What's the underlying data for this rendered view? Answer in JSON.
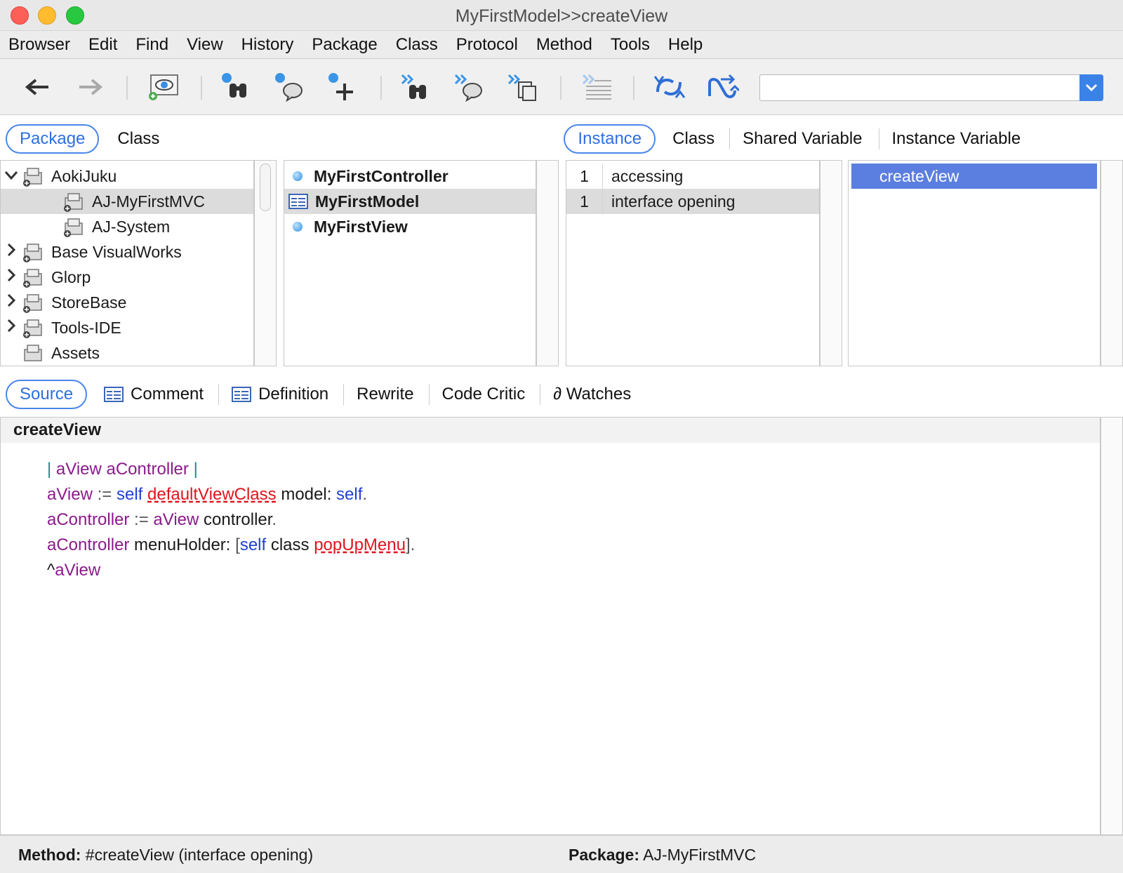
{
  "window": {
    "title": "MyFirstModel>>createView"
  },
  "menu": [
    "Browser",
    "Edit",
    "Find",
    "View",
    "History",
    "Package",
    "Class",
    "Protocol",
    "Method",
    "Tools",
    "Help"
  ],
  "toolbar": {
    "buttons": [
      "back-arrow-icon",
      "forward-arrow-icon",
      "inspect-eye-icon",
      "find-class-binoculars-icon",
      "find-method-icon",
      "add-icon",
      "find-next-class-icon",
      "find-next-method-icon",
      "find-next-copy-icon",
      "format-lines-icon",
      "sync-icon",
      "shuffle-icon"
    ],
    "search_value": ""
  },
  "top_tabs": {
    "left": [
      {
        "label": "Package",
        "active": true
      },
      {
        "label": "Class",
        "active": false
      }
    ],
    "right": [
      {
        "label": "Instance",
        "active": true
      },
      {
        "label": "Class",
        "active": false
      },
      {
        "label": "Shared Variable",
        "active": false
      },
      {
        "label": "Instance Variable",
        "active": false
      }
    ]
  },
  "packages": [
    {
      "label": "AokiJuku",
      "expanded": true
    },
    {
      "label": "AJ-MyFirstMVC",
      "selected": true
    },
    {
      "label": "AJ-System"
    },
    {
      "label": "Base VisualWorks"
    },
    {
      "label": "Glorp"
    },
    {
      "label": "StoreBase"
    },
    {
      "label": "Tools-IDE"
    },
    {
      "label": "Assets"
    }
  ],
  "classes": [
    {
      "label": "MyFirstController"
    },
    {
      "label": "MyFirstModel",
      "selected": true
    },
    {
      "label": "MyFirstView"
    }
  ],
  "protocols": [
    {
      "count": "1",
      "label": "accessing"
    },
    {
      "count": "1",
      "label": "interface opening",
      "selected": true
    }
  ],
  "methods": [
    {
      "label": "createView",
      "selected": true
    }
  ],
  "bottom_tabs": [
    {
      "label": "Source",
      "active": true
    },
    {
      "label": "Comment"
    },
    {
      "label": "Definition"
    },
    {
      "label": "Rewrite"
    },
    {
      "label": "Code Critic"
    },
    {
      "label": "∂ Watches"
    }
  ],
  "code": {
    "header": "createView",
    "line1": {
      "bar1": "|",
      "temps": " aView aController ",
      "bar2": "|"
    },
    "line2": {
      "v": "aView",
      "assign": " := ",
      "self": "self",
      "sel": "defaultViewClass",
      "kw": " model: ",
      "self2": "self",
      "dot": "."
    },
    "line3": {
      "v": "aController",
      "assign": " := ",
      "v2": "aView",
      "msg": " controller",
      "dot": "."
    },
    "line4": {
      "v": "aController",
      "kw": " menuHolder: ",
      "lb": "[",
      "self": "self",
      "msg": " class ",
      "sel": "popUpMenu",
      "rb": "]",
      "dot": "."
    },
    "line5": {
      "caret": "^",
      "v": "aView"
    }
  },
  "status": {
    "method_label": "Method:",
    "method_value": " #createView (interface opening)",
    "package_label": "Package:",
    "package_value": " AJ-MyFirstMVC"
  }
}
